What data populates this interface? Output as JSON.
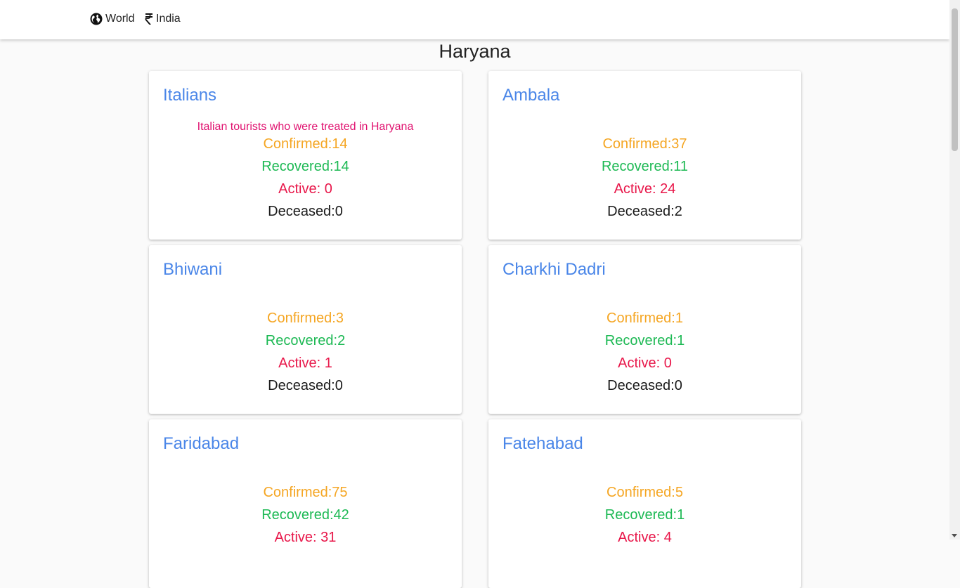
{
  "nav": {
    "world_label": "World",
    "india_label": "India",
    "world_icon": "globe-icon",
    "india_icon": "rupee-icon"
  },
  "page": {
    "title": "Haryana"
  },
  "colors": {
    "title": "#4a86e8",
    "confirmed": "#f5a623",
    "recovered": "#1db954",
    "active": "#e8174a",
    "deceased": "#1a1a1a",
    "note": "#e0116f"
  },
  "districts": [
    {
      "name": "Italians",
      "note": "Italian tourists who were treated in Haryana",
      "confirmed": "Confirmed:14",
      "recovered": "Recovered:14",
      "active": "Active: 0",
      "deceased": "Deceased:0"
    },
    {
      "name": "Ambala",
      "note": "",
      "confirmed": "Confirmed:37",
      "recovered": "Recovered:11",
      "active": "Active: 24",
      "deceased": "Deceased:2"
    },
    {
      "name": "Bhiwani",
      "note": "",
      "confirmed": "Confirmed:3",
      "recovered": "Recovered:2",
      "active": "Active: 1",
      "deceased": "Deceased:0"
    },
    {
      "name": "Charkhi Dadri",
      "note": "",
      "confirmed": "Confirmed:1",
      "recovered": "Recovered:1",
      "active": "Active: 0",
      "deceased": "Deceased:0"
    },
    {
      "name": "Faridabad",
      "note": "",
      "confirmed": "Confirmed:75",
      "recovered": "Recovered:42",
      "active": "Active: 31",
      "deceased": ""
    },
    {
      "name": "Fatehabad",
      "note": "",
      "confirmed": "Confirmed:5",
      "recovered": "Recovered:1",
      "active": "Active: 4",
      "deceased": ""
    }
  ]
}
